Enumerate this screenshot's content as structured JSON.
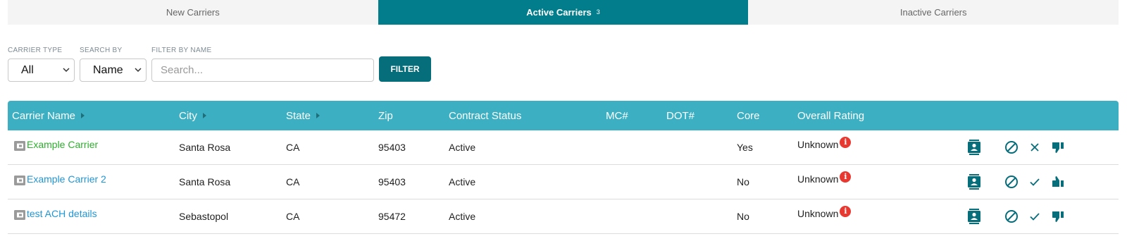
{
  "tabs": [
    {
      "label": "New Carriers",
      "count": ""
    },
    {
      "label": "Active Carriers",
      "count": "3"
    },
    {
      "label": "Inactive Carriers",
      "count": ""
    }
  ],
  "filters": {
    "carrier_type_label": "CARRIER TYPE",
    "carrier_type_value": "All",
    "search_by_label": "SEARCH BY",
    "search_by_value": "Name",
    "filter_by_name_label": "FILTER BY NAME",
    "search_placeholder": "Search...",
    "filter_button": "FILTER"
  },
  "table": {
    "headers": [
      "Carrier Name",
      "City",
      "State",
      "Zip",
      "Contract Status",
      "MC#",
      "DOT#",
      "Core",
      "Overall Rating"
    ],
    "rows": [
      {
        "name": "Example Carrier",
        "city": "Santa Rosa",
        "state": "CA",
        "zip": "95403",
        "status": "Active",
        "mc": "",
        "dot": "",
        "core": "Yes",
        "rating": "Unknown",
        "name_color": "green",
        "toggle_icon": "close-icon",
        "thumb_icon": "thumbs-down-icon"
      },
      {
        "name": "Example Carrier 2",
        "city": "Santa Rosa",
        "state": "CA",
        "zip": "95403",
        "status": "Active",
        "mc": "",
        "dot": "",
        "core": "No",
        "rating": "Unknown",
        "name_color": "blue",
        "toggle_icon": "check-icon",
        "thumb_icon": "thumbs-up-icon"
      },
      {
        "name": "test ACH details",
        "city": "Sebastopol",
        "state": "CA",
        "zip": "95472",
        "status": "Active",
        "mc": "",
        "dot": "",
        "core": "No",
        "rating": "Unknown",
        "name_color": "blue",
        "toggle_icon": "check-icon",
        "thumb_icon": "thumbs-down-icon"
      }
    ],
    "info_badge": "i"
  },
  "colors": {
    "tab_active": "#027d8c",
    "header_bg": "#3cb0c2",
    "filter_button": "#066d7b",
    "icon_teal": "#066d7b",
    "link_green": "#2eaf2e",
    "link_blue": "#2196d4",
    "badge_red": "#e8382f"
  }
}
